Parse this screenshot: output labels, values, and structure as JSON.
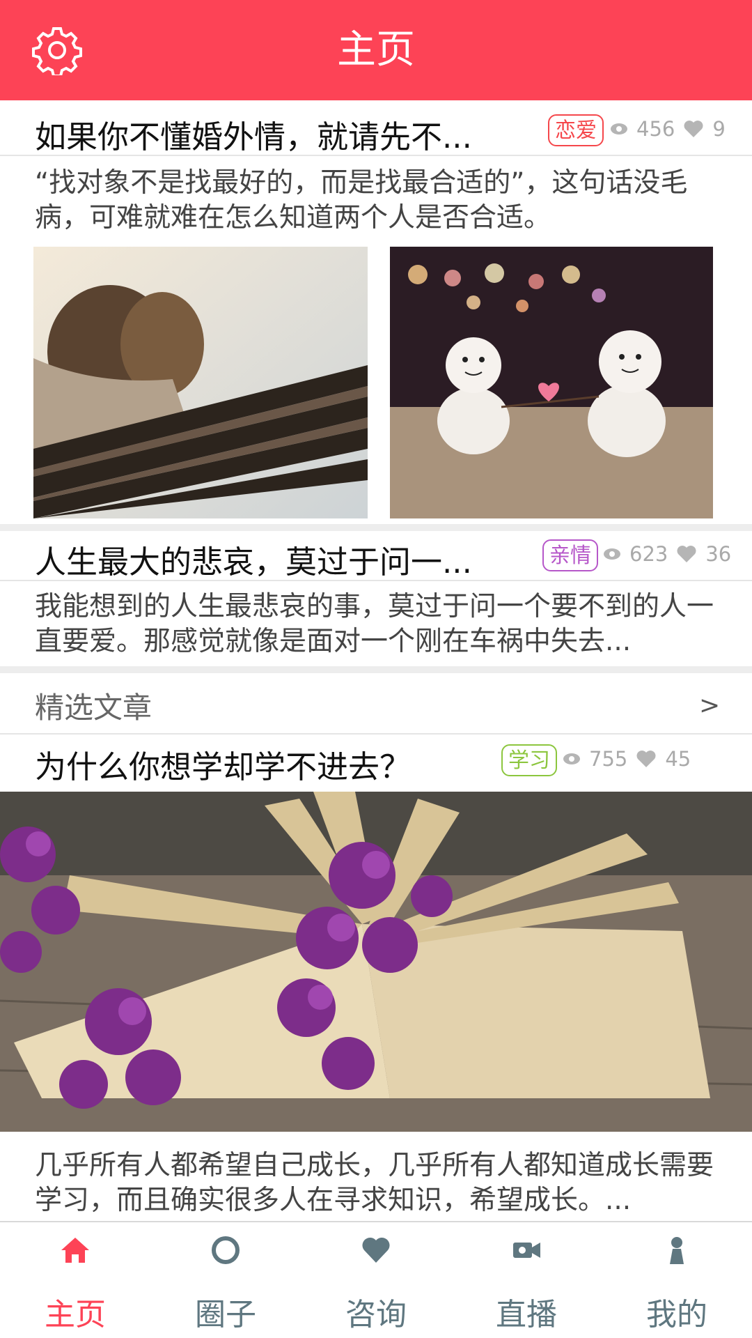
{
  "header": {
    "title": "主页"
  },
  "articles": [
    {
      "title": "如果你不懂婚外情，就请先不...",
      "tag": "恋爱",
      "tag_color": "#f5474b",
      "views": "456",
      "likes": "9",
      "excerpt": "“找对象不是找最好的，而是找最合适的”，这句话没毛病，可难就难在怎么知道两个人是否合适。"
    },
    {
      "title": "人生最大的悲哀，莫过于问一...",
      "tag": "亲情",
      "tag_color": "#b657c9",
      "views": "623",
      "likes": "36",
      "excerpt": "我能想到的人生最悲哀的事，莫过于问一个要不到的人一直要爱。那感觉就像是面对一个刚在车祸中失去..."
    }
  ],
  "featured_section": {
    "label": "精选文章",
    "more": ">"
  },
  "featured_article": {
    "title": "为什么你想学却学不进去？",
    "tag": "学习",
    "tag_color": "#8cc63e",
    "views": "755",
    "likes": "45",
    "excerpt": "几乎所有人都希望自己成长，几乎所有人都知道成长需要学习，而且确实很多人在寻求知识，希望成长。..."
  },
  "nav": {
    "items": [
      {
        "label": "主页",
        "icon": "home-icon",
        "active": true
      },
      {
        "label": "圈子",
        "icon": "circle-icon",
        "active": false
      },
      {
        "label": "咨询",
        "icon": "heart-icon",
        "active": false
      },
      {
        "label": "直播",
        "icon": "video-camera-icon",
        "active": false
      },
      {
        "label": "我的",
        "icon": "person-icon",
        "active": false
      }
    ],
    "active_color": "#fd4356",
    "inactive_color": "#5f7780"
  }
}
